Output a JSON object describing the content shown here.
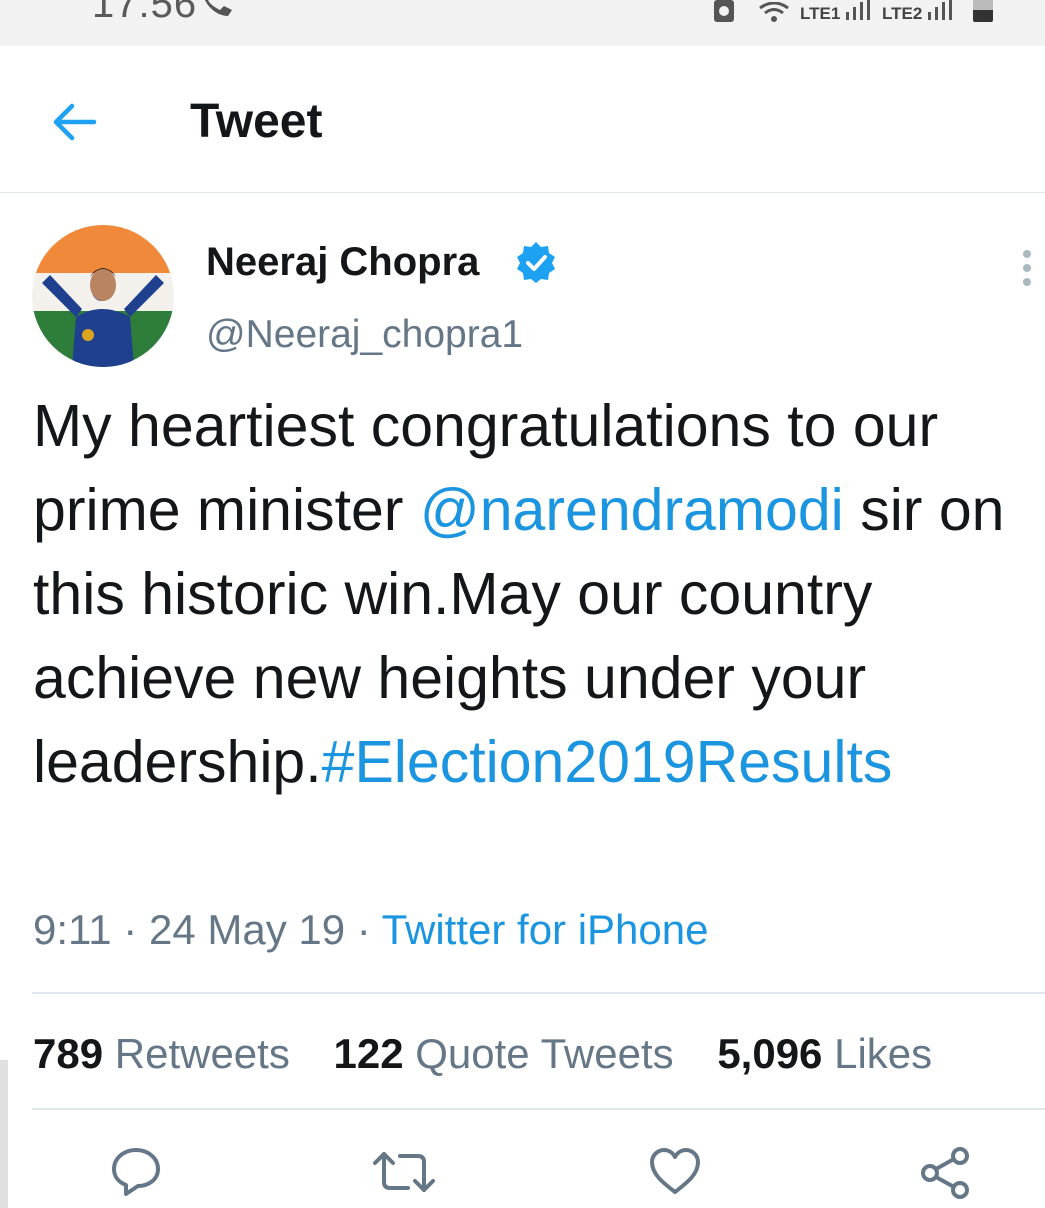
{
  "status_bar": {
    "time": "17:56",
    "lte1": "LTE1",
    "lte2": "LTE2"
  },
  "header": {
    "back_icon": "arrow-left-icon",
    "title": "Tweet"
  },
  "tweet": {
    "author_name": "Neeraj Chopra",
    "author_handle": "@Neeraj_chopra1",
    "text_part1": "My heartiest congratulations to our prime minister ",
    "mention": "@narendramodi",
    "text_part2": " sir on this historic win.May our country achieve new heights under your leadership.",
    "hashtag": "#Election2019Results",
    "time": "9:11",
    "date": "24 May 19",
    "source": "Twitter for iPhone",
    "separator": " · "
  },
  "stats": {
    "retweets_count": "789",
    "retweets_label": "Retweets",
    "quotes_count": "122",
    "quotes_label": "Quote Tweets",
    "likes_count": "5,096",
    "likes_label": "Likes"
  },
  "actions": [
    "reply-icon",
    "retweet-icon",
    "like-icon",
    "share-icon"
  ],
  "colors": {
    "accent": "#1b95e0",
    "text": "#14171a",
    "secondary": "#657786",
    "divider": "#e1e8ed"
  }
}
